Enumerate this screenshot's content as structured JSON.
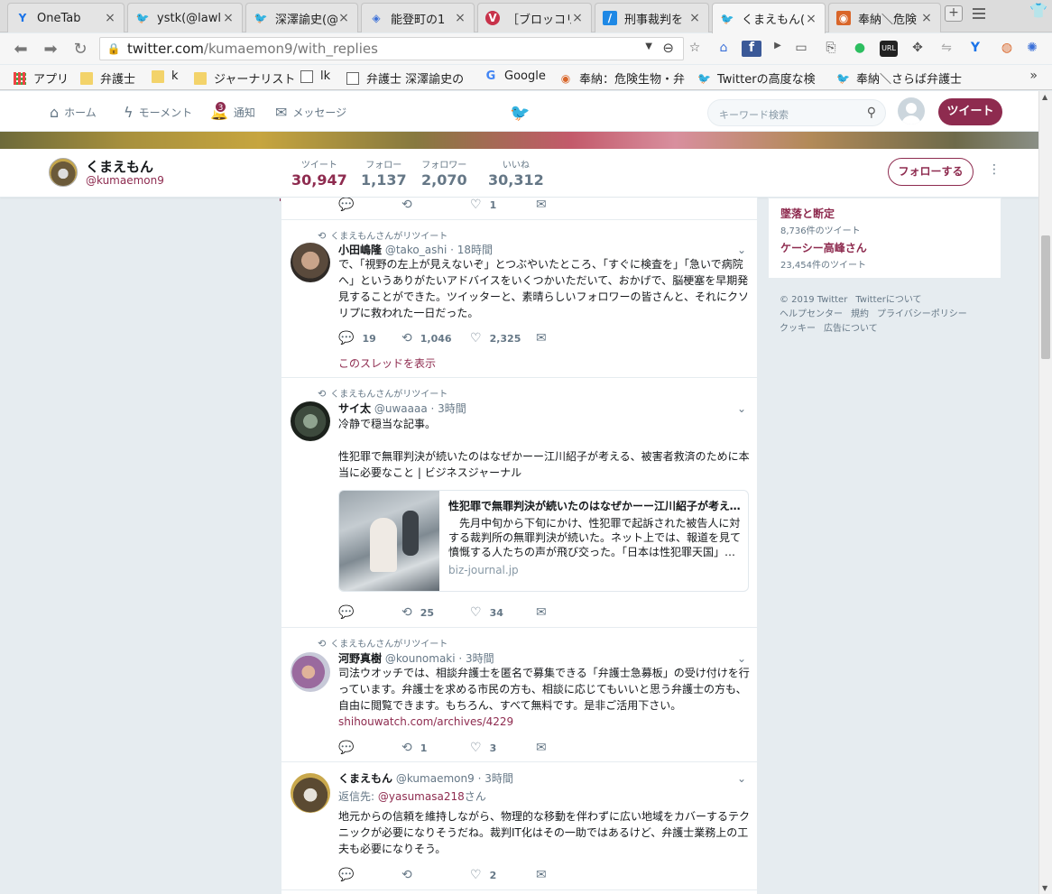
{
  "browser": {
    "tabs": [
      {
        "title": "OneTab",
        "icon": "onetab-icon",
        "active": false
      },
      {
        "title": "ystk(@lawl",
        "icon": "twitter-icon",
        "active": false
      },
      {
        "title": "深澤諭史(@",
        "icon": "twitter-icon",
        "active": false
      },
      {
        "title": "能登町の1",
        "icon": "cube-icon",
        "active": false
      },
      {
        "title": "［ブロッコリ",
        "icon": "vivaldi-icon",
        "active": false
      },
      {
        "title": "刑事裁判を",
        "icon": "feather-icon",
        "active": false
      },
      {
        "title": "くまえもん(@",
        "icon": "twitter-icon",
        "active": true
      },
      {
        "title": "奉納＼危険",
        "icon": "site-icon",
        "active": false
      }
    ],
    "url_host": "twitter.com",
    "url_path": "/kumaemon9/with_replies",
    "bookmarks": [
      {
        "label": "アプリ",
        "icon": "apps"
      },
      {
        "label": "弁護士",
        "icon": "folder"
      },
      {
        "label": "k",
        "icon": "folder"
      },
      {
        "label": "ジャーナリスト",
        "icon": "folder"
      },
      {
        "label": "lk",
        "icon": "page"
      },
      {
        "label": "弁護士 深澤諭史の",
        "icon": "page"
      },
      {
        "label": "Google",
        "icon": "google"
      },
      {
        "label": "奉納：危険生物・弁",
        "icon": "site"
      },
      {
        "label": "Twitterの高度な検",
        "icon": "twitter"
      },
      {
        "label": "奉納＼さらば弁護士",
        "icon": "twitter"
      }
    ]
  },
  "twitter_nav": {
    "home": "ホーム",
    "moments": "モーメント",
    "notifications": "通知",
    "notifications_count": "3",
    "messages": "メッセージ",
    "search_placeholder": "キーワード検索",
    "tweet_button": "ツイート"
  },
  "profile": {
    "name": "くまえもん",
    "handle": "@kumaemon9",
    "stats": [
      {
        "label": "ツイート",
        "value": "30,947",
        "active": true
      },
      {
        "label": "フォロー",
        "value": "1,137",
        "active": false
      },
      {
        "label": "フォロワー",
        "value": "2,070",
        "active": false
      },
      {
        "label": "いいね",
        "value": "30,312",
        "active": false
      }
    ],
    "follow_button": "フォローする"
  },
  "sidebar": {
    "trends": [
      {
        "name": "墜落と断定",
        "count": "8,736件のツイート"
      },
      {
        "name": "ケーシー高峰さん",
        "count": "23,454件のツイート"
      }
    ],
    "footer": [
      "© 2019 Twitter",
      "Twitterについて",
      "ヘルプセンター",
      "規約",
      "プライバシーポリシー",
      "クッキー",
      "広告について"
    ]
  },
  "timeline": {
    "top_partial": {
      "reply": "",
      "retweet": "",
      "like": "1"
    },
    "tweets": [
      {
        "retweet_note": "くまえもんさんがリツイート",
        "name": "小田嶋隆",
        "handle": "@tako_ashi",
        "time": "· 18時間",
        "text": "で、「視野の左上が見えないぞ」とつぶやいたところ、「すぐに検査を」「急いで病院へ」というありがたいアドバイスをいくつかいただいて、おかげで、脳梗塞を早期発見することができた。ツイッターと、素晴らしいフォロワーの皆さんと、それにクソリプに救われた一日だった。",
        "replies": "19",
        "retweets": "1,046",
        "likes": "2,325",
        "thread_link": "このスレッドを表示"
      },
      {
        "retweet_note": "くまえもんさんがリツイート",
        "name": "サイ太",
        "handle": "@uwaaaa",
        "time": "· 3時間",
        "text": "冷静で穏当な記事。",
        "text2": "性犯罪で無罪判決が続いたのはなぜかーー江川紹子が考える、被害者救済のために本当に必要なこと | ビジネスジャーナル",
        "card_title": "性犯罪で無罪判決が続いたのはなぜかーー江川紹子が考える、被害者救済のために本当に必要なこと",
        "card_desc": "　先月中旬から下旬にかけ、性犯罪で起訴された被告人に対する裁判所の無罪判決が続いた。ネット上では、報道を見て憤慨する人たちの声が飛び交った。「日本は性犯罪天国」…",
        "card_domain": "biz-journal.jp",
        "replies": "",
        "retweets": "25",
        "likes": "34"
      },
      {
        "retweet_note": "くまえもんさんがリツイート",
        "name": "河野真樹",
        "handle": "@kounomaki",
        "time": "· 3時間",
        "text": "司法ウオッチでは、相談弁護士を匿名で募集できる「弁護士急募板」の受け付けを行っています。弁護士を求める市民の方も、相談に応じてもいいと思う弁護士の方も、自由に閲覧できます。もちろん、すべて無料です。是非ご活用下さい。",
        "link": "shihouwatch.com/archives/4229",
        "replies": "",
        "retweets": "1",
        "likes": "3"
      },
      {
        "retweet_note": "",
        "name": "くまえもん",
        "handle": "@kumaemon9",
        "time": "· 3時間",
        "reply_prefix": "返信先: ",
        "reply_to": "@yasumasa218",
        "reply_suffix": "さん",
        "text": "地元からの信頼を維持しながら、物理的な移動を伴わずに広い地域をカバーするテクニックが必要になりそうだね。裁判IT化はその一助ではあるけど、弁護士業務上の工夫も必要になりそう。",
        "replies": "",
        "retweets": "",
        "likes": "2"
      }
    ]
  },
  "colors": {
    "accent": "#8e2b4f",
    "twitter_blue": "#1da1f2",
    "muted": "#657786",
    "background": "#e6ecf0"
  }
}
